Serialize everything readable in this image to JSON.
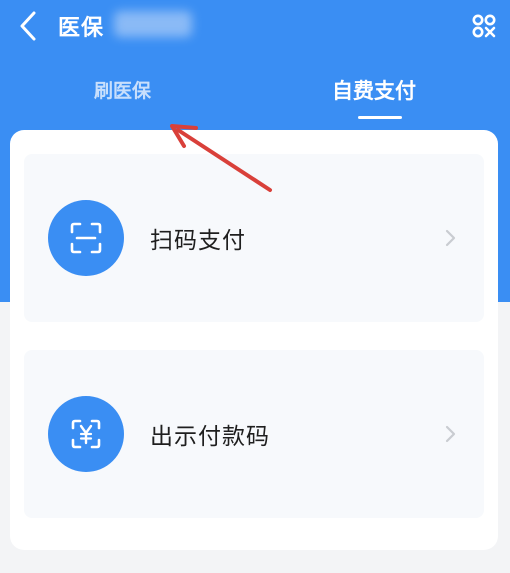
{
  "header": {
    "title": "医保",
    "back_icon": "chevron-left-icon",
    "qr_icon": "qr-scan-icon"
  },
  "tabs": [
    {
      "label": "刷医保",
      "active": false
    },
    {
      "label": "自费支付",
      "active": true
    }
  ],
  "options": [
    {
      "label": "扫码支付",
      "icon": "scan-frame-icon"
    },
    {
      "label": "出示付款码",
      "icon": "yuan-code-icon"
    }
  ],
  "colors": {
    "primary_blue": "#3a8ef3",
    "annotation_arrow": "#d9403a"
  }
}
